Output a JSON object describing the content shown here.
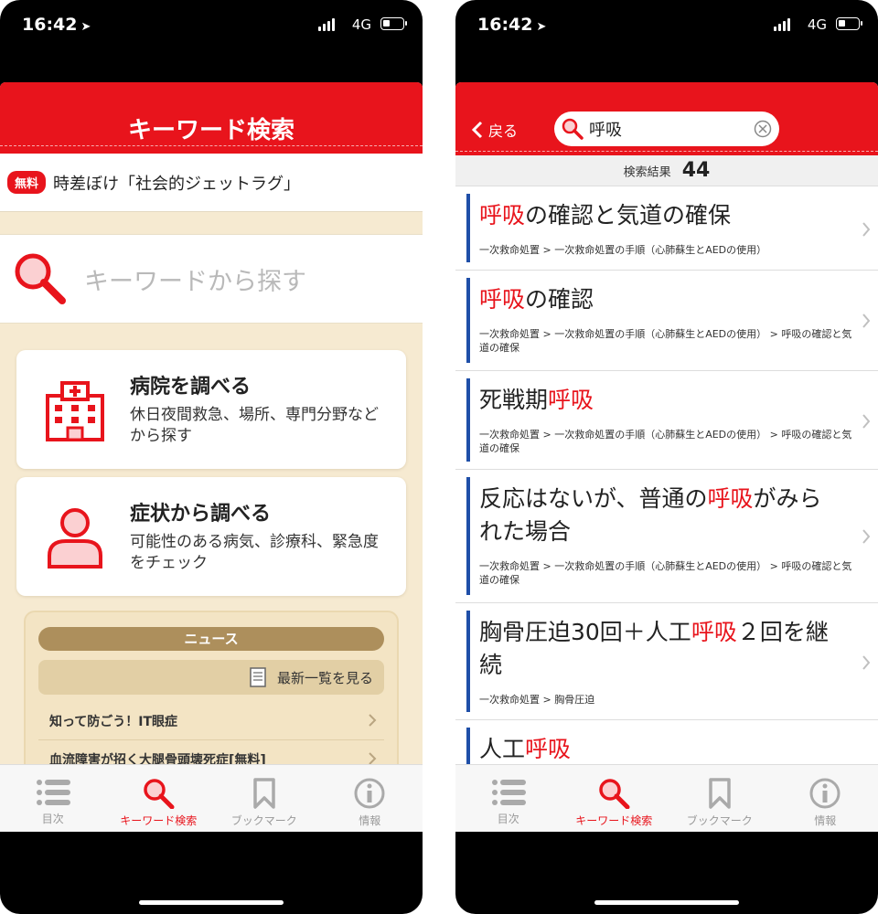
{
  "status": {
    "time": "16:42",
    "network": "4G"
  },
  "left": {
    "title": "キーワード検索",
    "notice": {
      "badge": "無料",
      "text": "時差ぼけ「社会的ジェットラグ」"
    },
    "search": {
      "placeholder": "キーワードから探す"
    },
    "cards": [
      {
        "title": "病院を調べる",
        "desc": "休日夜間救急、場所、専門分野などから探す"
      },
      {
        "title": "症状から調べる",
        "desc": "可能性のある病気、診療科、緊急度をチェック"
      }
    ],
    "news": {
      "header": "ニュース",
      "view_all": "最新一覧を見る",
      "items": [
        "知って防ごう！IT眼症",
        "血流障害が招く大腿骨頭壊死症[無料]"
      ]
    }
  },
  "right": {
    "back": "戻る",
    "query": "呼吸",
    "count_label": "検索結果",
    "count": "44",
    "results": [
      {
        "parts": [
          [
            "呼吸",
            true
          ],
          [
            "の確認と気道の確保",
            false
          ]
        ],
        "path": "一次救命処置 > 一次救命処置の手順（心肺蘇生とAEDの使用）"
      },
      {
        "parts": [
          [
            "呼吸",
            true
          ],
          [
            "の確認",
            false
          ]
        ],
        "path": "一次救命処置 > 一次救命処置の手順（心肺蘇生とAEDの使用） > 呼吸の確認と気道の確保"
      },
      {
        "parts": [
          [
            "死戦期",
            false
          ],
          [
            "呼吸",
            true
          ]
        ],
        "path": "一次救命処置 > 一次救命処置の手順（心肺蘇生とAEDの使用） > 呼吸の確認と気道の確保"
      },
      {
        "parts": [
          [
            "反応はないが、普通の",
            false
          ],
          [
            "呼吸",
            true
          ],
          [
            "がみられた場合",
            false
          ]
        ],
        "path": "一次救命処置 > 一次救命処置の手順（心肺蘇生とAEDの使用） > 呼吸の確認と気道の確保"
      },
      {
        "parts": [
          [
            "胸骨圧迫30回＋人工",
            false
          ],
          [
            "呼吸",
            true
          ],
          [
            "２回を継続",
            false
          ]
        ],
        "path": "一次救命処置 > 胸骨圧迫"
      },
      {
        "parts": [
          [
            "人工",
            false
          ],
          [
            "呼吸",
            true
          ]
        ],
        "path": ""
      }
    ]
  },
  "tabs": [
    {
      "label": "目次",
      "icon": "list-icon",
      "active": false
    },
    {
      "label": "キーワード検索",
      "icon": "search-icon",
      "active": true
    },
    {
      "label": "ブックマーク",
      "icon": "bookmark-icon",
      "active": false
    },
    {
      "label": "情報",
      "icon": "info-icon",
      "active": false
    }
  ],
  "colors": {
    "accent": "#e8141c",
    "result_bar": "#1f4fa8",
    "news_header": "#ad8f5c",
    "background": "#f6ead1"
  }
}
